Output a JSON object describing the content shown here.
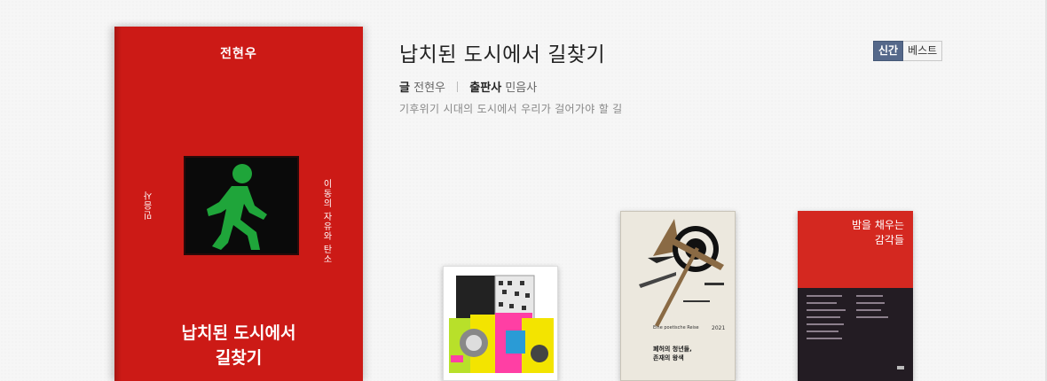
{
  "featured": {
    "title": "납치된 도시에서 길찾기",
    "author_label": "글",
    "author": "전현우",
    "publisher_label": "출판사",
    "publisher": "민음사",
    "description": "기후위기 시대의 도시에서 우리가 걸어가야 할 길",
    "cover": {
      "author": "전현우",
      "title_line1": "납치된 도시에서",
      "title_line2": "길찾기",
      "side_left": "민음사",
      "side_right": "이동의 자유와 탄소",
      "background_color": "#cc1a16",
      "sign_icon": "walking-person-icon"
    }
  },
  "toggle": {
    "new_label": "신간",
    "best_label": "베스트",
    "active": "신간"
  },
  "thumbnails": [
    {
      "name": "thumb-book-1",
      "colors": [
        "#ff3fa4",
        "#b8e02a",
        "#f3e400"
      ]
    },
    {
      "name": "thumb-book-2",
      "title_line1": "폐허의 청년들,",
      "title_line2": "존재의 왕색",
      "year": "2021"
    },
    {
      "name": "thumb-book-3",
      "title_line1": "밤을 채우는",
      "title_line2": "감각들"
    }
  ]
}
